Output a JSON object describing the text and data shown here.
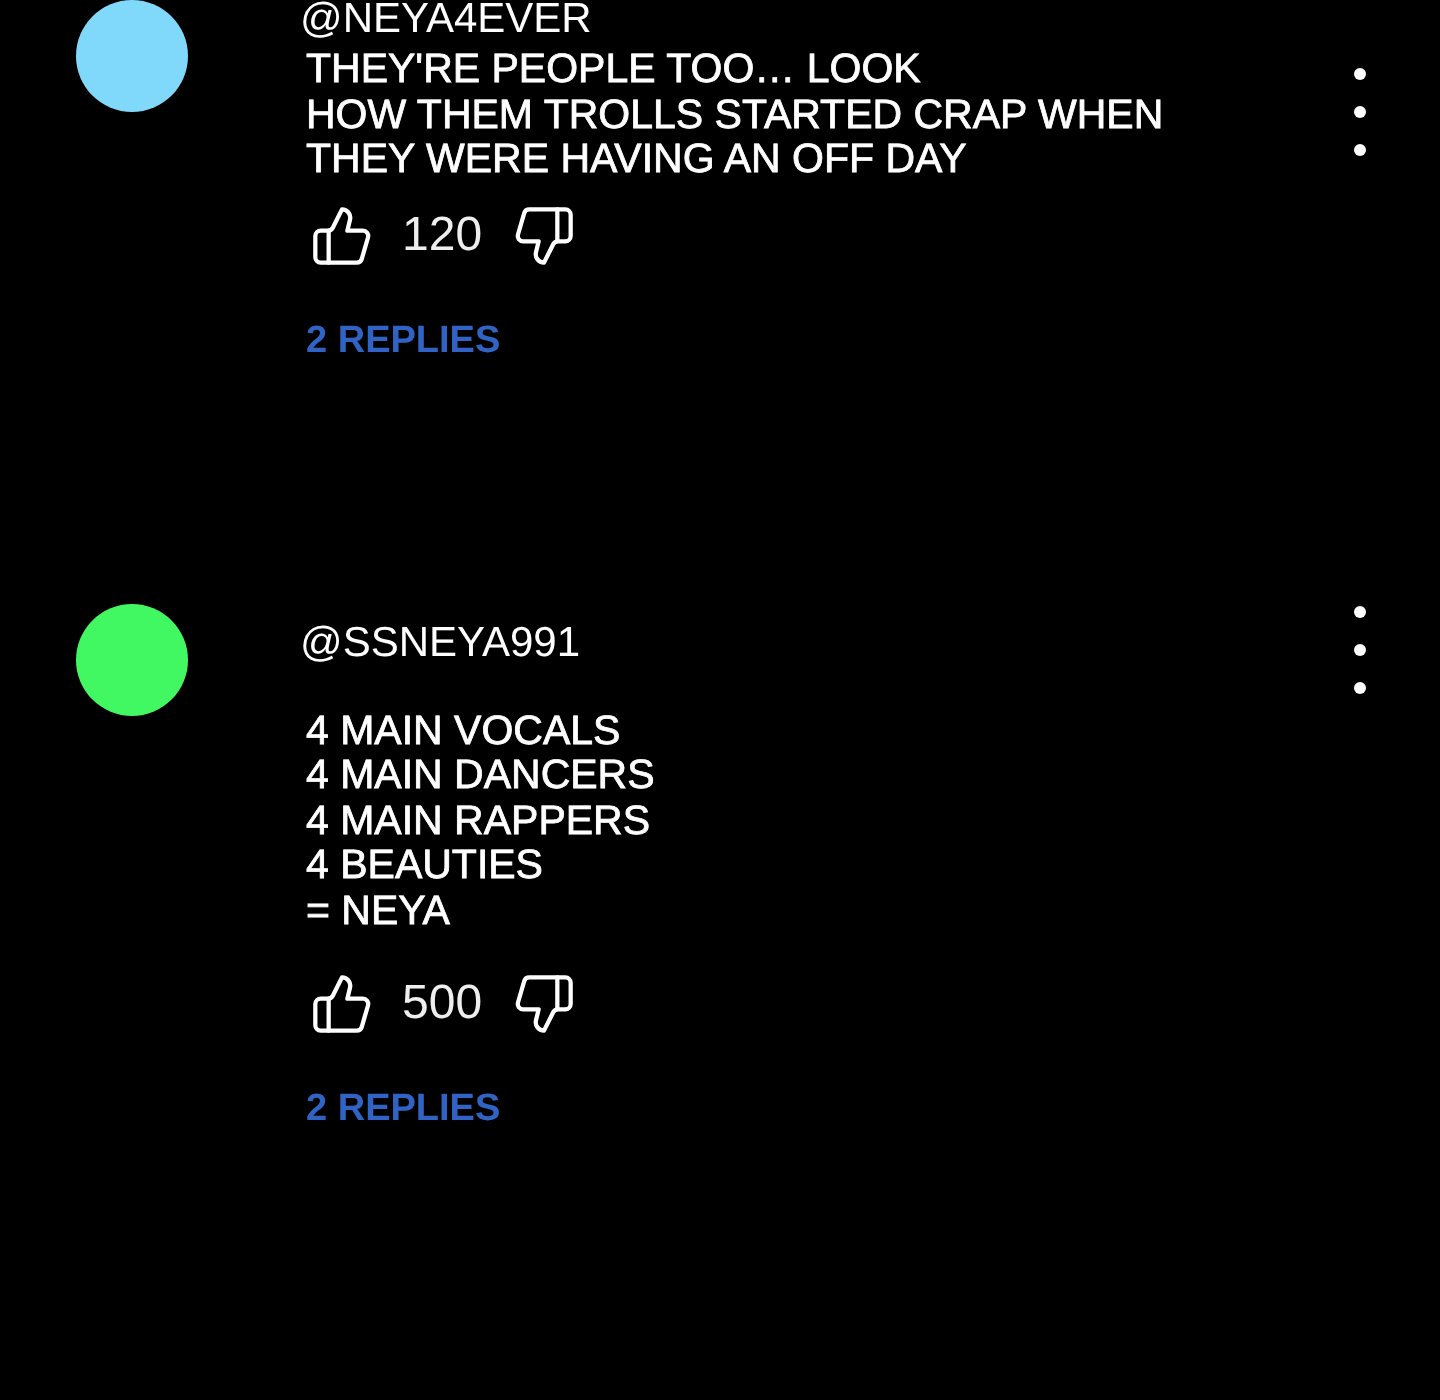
{
  "comments": [
    {
      "username": "@NEYA4EVER",
      "color": "#80d8fa",
      "text": "THEY'RE PEOPLE TOO… LOOK\nHOW THEM TROLLS STARTED CRAP WHEN\nTHEY WERE HAVING AN OFF DAY",
      "likes": "120",
      "replies": "2 REPLIES"
    },
    {
      "username": "@SSNEYA991",
      "color": "#41f762",
      "text": "4 MAIN VOCALS\n4 MAIN DANCERS\n4 MAIN RAPPERS\n4 BEAUTIES\n= NEYA",
      "likes": "500",
      "replies": "2 REPLIES"
    }
  ]
}
